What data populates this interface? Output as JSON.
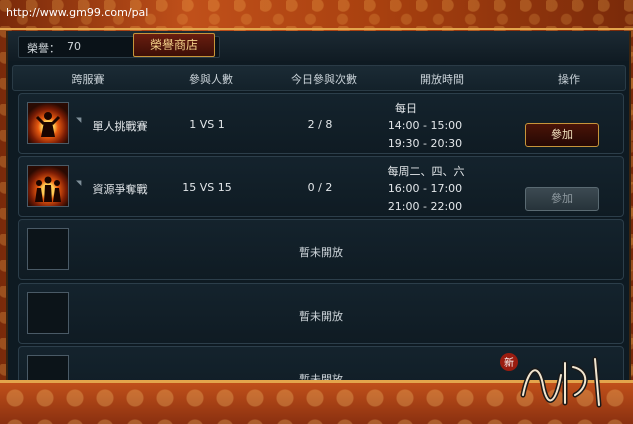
{
  "url": "http://www.gm99.com/pal",
  "honor": {
    "label": "榮譽：",
    "value": "70",
    "shop_button": "榮譽商店"
  },
  "columns": [
    "跨服賽",
    "參與人數",
    "今日參與次數",
    "開放時間",
    "操作"
  ],
  "rows": [
    {
      "name": "單人挑戰賽",
      "players": "1 VS 1",
      "today": "2 / 8",
      "times": [
        "每日",
        "14:00 - 15:00",
        "19:30 - 20:30"
      ],
      "action": "參加",
      "action_enabled": true,
      "icon": "fire-warrior-icon"
    },
    {
      "name": "資源爭奪戰",
      "players": "15 VS 15",
      "today": "0 / 2",
      "times": [
        "每周二、四、六",
        "16:00 - 17:00",
        "21:00 - 22:00"
      ],
      "action": "參加",
      "action_enabled": false,
      "icon": "fire-team-icon"
    }
  ],
  "closed_rows": [
    "暫未開放",
    "暫未開放",
    "暫未開放"
  ],
  "colors": {
    "accent": "#c7953a",
    "panel": "#0e1a22",
    "frame": "#c0501a"
  }
}
